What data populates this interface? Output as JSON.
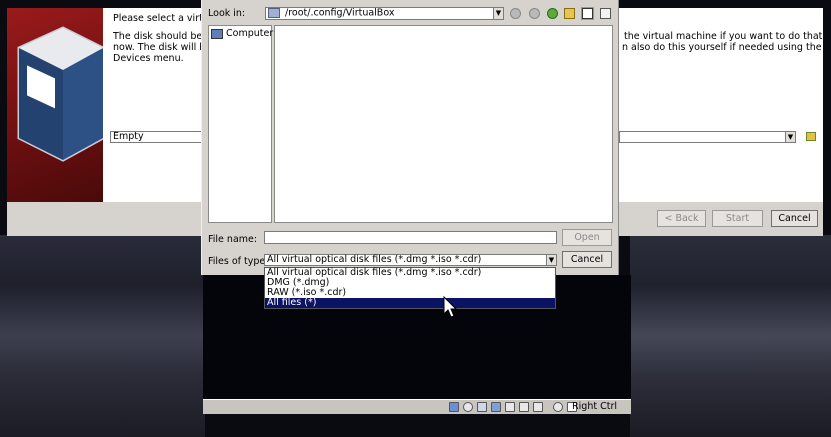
{
  "wizard": {
    "intro_partial": "Please select a virtua",
    "left_text_line1": "The disk should be s",
    "left_text_line2": "now. The disk will be",
    "left_text_line3": "Devices menu.",
    "right_text_line1": "the virtual machine if you want to do that",
    "right_text_line2": "n also do this yourself if needed using the",
    "disk_combo_value": "Empty",
    "back_label": "< Back",
    "start_label": "Start",
    "cancel_label": "Cancel"
  },
  "file_dialog": {
    "look_in_label": "Look in:",
    "look_in_value": "/root/.config/VirtualBox",
    "sidebar_items": [
      {
        "label": "Computer"
      }
    ],
    "file_name_label": "File name:",
    "file_name_value": "",
    "open_label": "Open",
    "files_of_type_label": "Files of type:",
    "files_of_type_value": "All virtual optical disk files (*.dmg *.iso *.cdr)",
    "cancel_label": "Cancel",
    "type_options": [
      {
        "label": "All virtual optical disk files (*.dmg *.iso *.cdr)",
        "selected": false
      },
      {
        "label": "DMG (*.dmg)",
        "selected": false
      },
      {
        "label": "RAW (*.iso *.cdr)",
        "selected": false
      },
      {
        "label": "All files (*)",
        "selected": true
      }
    ]
  },
  "vm_statusbar": {
    "host_key": "Right Ctrl"
  },
  "colors": {
    "selection": "#0b1364",
    "dialog_bg": "#d6d3ce",
    "banner_red": "#7a1414"
  }
}
